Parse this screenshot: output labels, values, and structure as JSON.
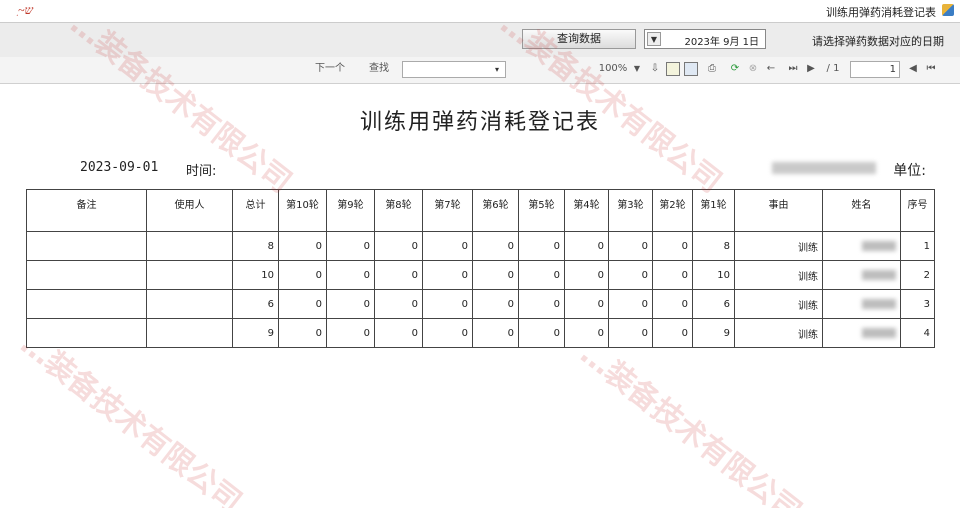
{
  "window": {
    "title": "训练用弹药消耗登记表"
  },
  "params": {
    "prompt": "请选择弹药数据对应的日期",
    "date_value": "2023年 9月 1日",
    "dropdown_glyph": "▼",
    "query_button": "查询数据"
  },
  "toolbar": {
    "page_input": "1",
    "page_total": "/ 1",
    "zoom": "100%",
    "find_label": "查找",
    "next_label": "下一个"
  },
  "report": {
    "title": "训练用弹药消耗登记表",
    "unit_label": "单位:",
    "unit_value": "",
    "date_label": "时间:",
    "date_value": "2023-09-01",
    "headers": [
      "序号",
      "姓名",
      "事由",
      "第1轮",
      "第2轮",
      "第3轮",
      "第4轮",
      "第5轮",
      "第6轮",
      "第7轮",
      "第8轮",
      "第9轮",
      "第10轮",
      "总计",
      "使用人",
      "备注"
    ],
    "rows": [
      {
        "seq": "1",
        "name": "",
        "reason": "训练",
        "rounds": [
          "8",
          "0",
          "0",
          "0",
          "0",
          "0",
          "0",
          "0",
          "0",
          "0"
        ],
        "total": "8",
        "user": "",
        "note": ""
      },
      {
        "seq": "2",
        "name": "",
        "reason": "训练",
        "rounds": [
          "10",
          "0",
          "0",
          "0",
          "0",
          "0",
          "0",
          "0",
          "0",
          "0"
        ],
        "total": "10",
        "user": "",
        "note": ""
      },
      {
        "seq": "3",
        "name": "",
        "reason": "训练",
        "rounds": [
          "6",
          "0",
          "0",
          "0",
          "0",
          "0",
          "0",
          "0",
          "0",
          "0"
        ],
        "total": "6",
        "user": "",
        "note": ""
      },
      {
        "seq": "4",
        "name": "",
        "reason": "训练",
        "rounds": [
          "9",
          "0",
          "0",
          "0",
          "0",
          "0",
          "0",
          "0",
          "0",
          "0"
        ],
        "total": "9",
        "user": "",
        "note": ""
      }
    ]
  },
  "watermark": {
    "text": "…装备技术有限公司"
  },
  "colors": {
    "watermark": "#c82828",
    "param_bar": "#ececec",
    "toolbar": "#f4f4f4"
  },
  "icons": [
    "first-page-icon",
    "prev-page-icon",
    "next-page-icon",
    "last-page-icon",
    "back-icon",
    "stop-icon",
    "refresh-icon",
    "print-icon",
    "page-setup-icon",
    "layout-icon",
    "export-icon",
    "zoom-dropdown-icon"
  ]
}
